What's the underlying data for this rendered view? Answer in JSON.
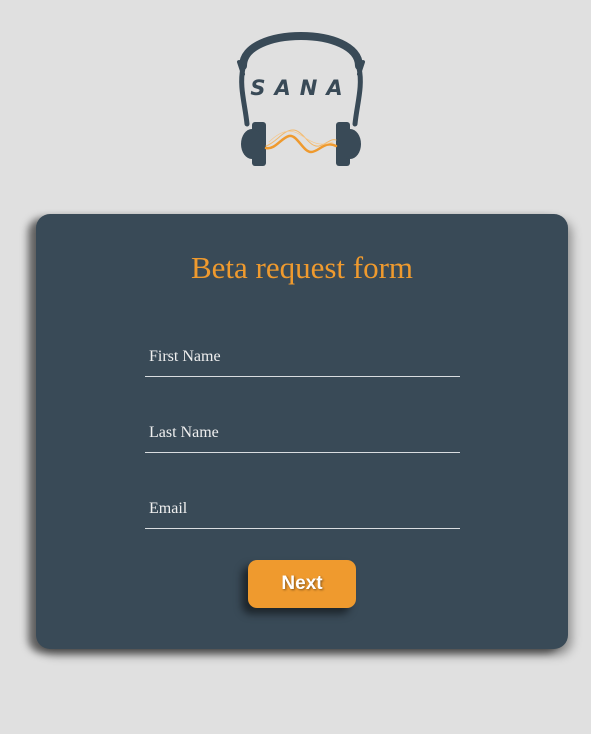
{
  "logo": {
    "text": "SANA",
    "icon": "headphones-icon"
  },
  "form": {
    "title": "Beta request form",
    "fields": [
      {
        "name": "first-name",
        "placeholder": "First Name",
        "value": ""
      },
      {
        "name": "last-name",
        "placeholder": "Last Name",
        "value": ""
      },
      {
        "name": "email",
        "placeholder": "Email",
        "value": ""
      }
    ],
    "submit_label": "Next"
  },
  "colors": {
    "page_background": "#e0e0e0",
    "card_background": "#394a57",
    "accent": "#ef9a2e",
    "field_underline": "#d9dde0"
  }
}
